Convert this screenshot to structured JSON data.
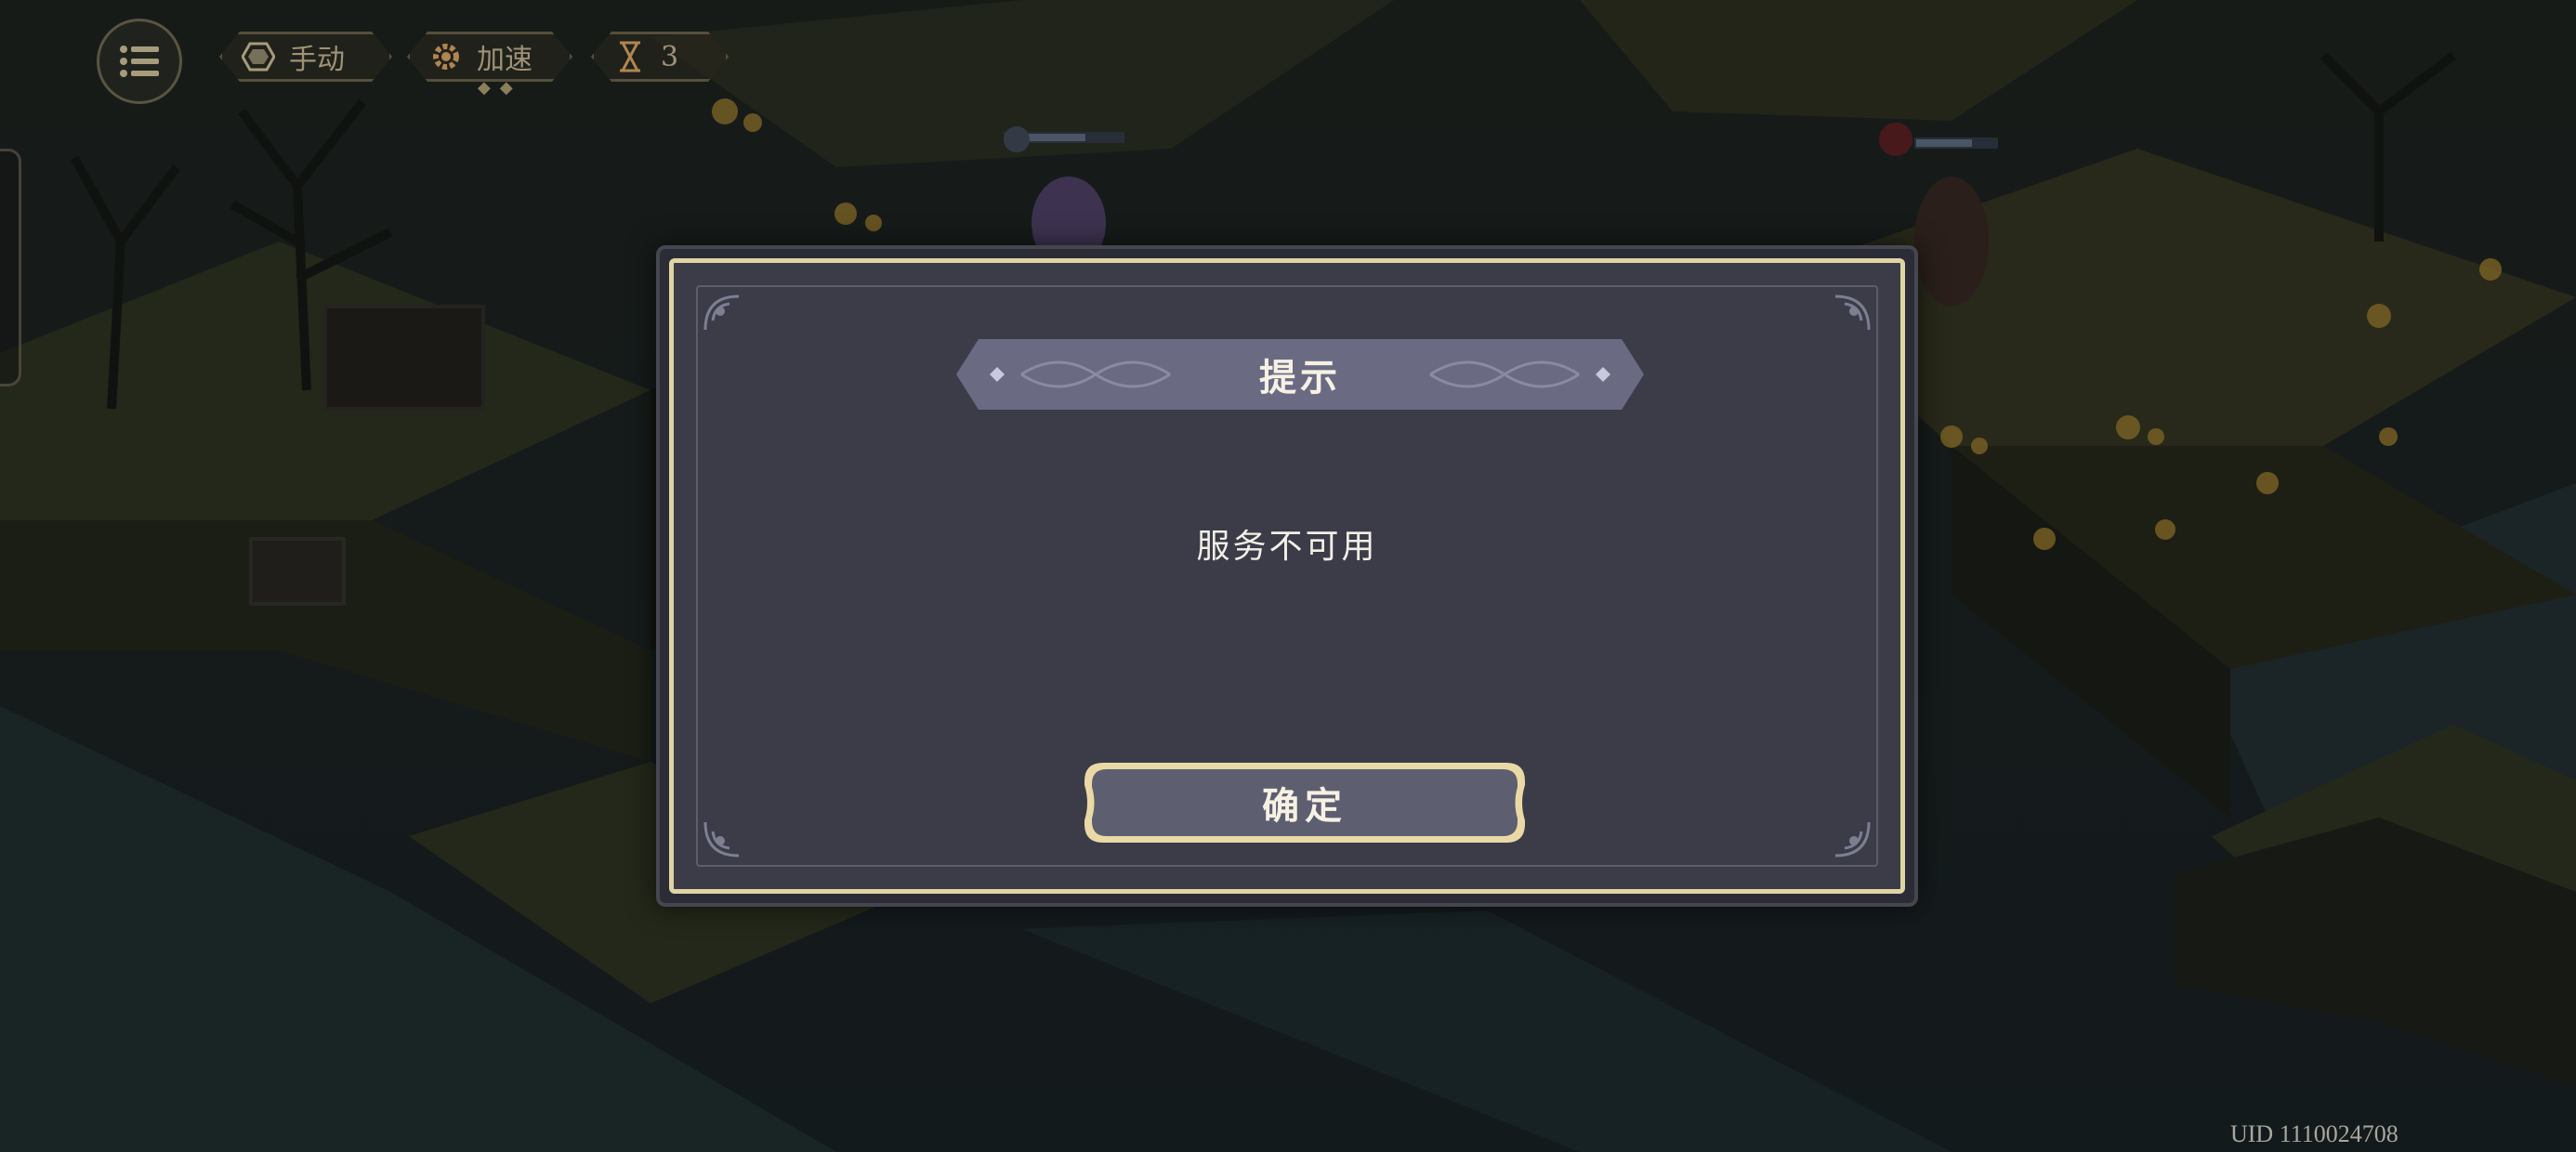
{
  "hud": {
    "menu_icon": "menu-list-icon",
    "buttons": [
      {
        "label": "手动",
        "icon": "hexagon-icon"
      },
      {
        "label": "加速",
        "icon": "gear-icon"
      },
      {
        "label": "3",
        "icon": "hourglass-icon"
      }
    ]
  },
  "dialog": {
    "title": "提示",
    "message": "服务不可用",
    "confirm_label": "确定"
  },
  "footer": {
    "uid_text": "UID 1110024708"
  },
  "colors": {
    "dialog_bg": "#3b3c48",
    "gold_border": "#e0d4a4",
    "banner": "#6a6b82",
    "text": "#f6f1e4"
  }
}
